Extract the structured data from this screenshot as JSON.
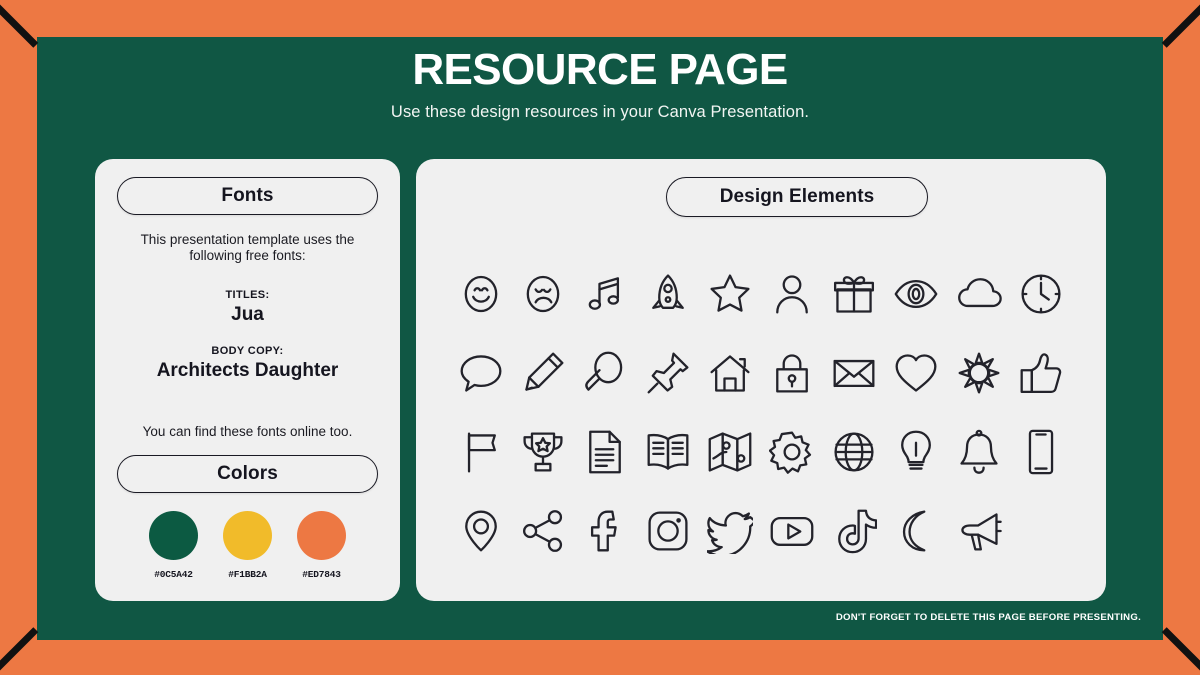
{
  "theme": {
    "border_color": "#ED7843",
    "panel_color": "#105744",
    "card_color": "#F0F0F0",
    "ink_color": "#15151F",
    "corner_mark_color": "#111111"
  },
  "header": {
    "title": "RESOURCE PAGE",
    "subtitle": "Use these design resources in your Canva Presentation."
  },
  "fonts_card": {
    "pill_label": "Fonts",
    "intro_text": "This presentation template uses the following free fonts:",
    "titles_label": "TITLES:",
    "titles_value": "Jua",
    "body_label": "BODY COPY:",
    "body_value": "Architects Daughter",
    "outro_text": "You can find these fonts online too."
  },
  "colors_section": {
    "pill_label": "Colors",
    "swatches": [
      {
        "name": "green-swatch",
        "hex": "#0C5A42"
      },
      {
        "name": "yellow-swatch",
        "hex": "#F1BB2A"
      },
      {
        "name": "orange-swatch",
        "hex": "#ED7843"
      }
    ]
  },
  "elements_card": {
    "pill_label": "Design Elements",
    "icons": [
      "smiley-face-icon",
      "sad-face-icon",
      "music-note-icon",
      "rocket-icon",
      "star-icon",
      "person-icon",
      "gift-icon",
      "eye-icon",
      "cloud-icon",
      "clock-icon",
      "speech-bubble-icon",
      "pencil-icon",
      "magnifier-icon",
      "pushpin-icon",
      "house-icon",
      "lock-icon",
      "envelope-icon",
      "heart-icon",
      "sun-icon",
      "thumbs-up-icon",
      "flag-icon",
      "trophy-icon",
      "document-icon",
      "book-icon",
      "map-icon",
      "gear-icon",
      "globe-icon",
      "lightbulb-icon",
      "bell-icon",
      "phone-icon",
      "location-pin-icon",
      "share-icon",
      "facebook-icon",
      "instagram-icon",
      "twitter-icon",
      "youtube-icon",
      "tiktok-icon",
      "moon-icon",
      "megaphone-icon"
    ]
  },
  "footer": {
    "note": "DON'T FORGET TO DELETE THIS PAGE BEFORE PRESENTING."
  }
}
